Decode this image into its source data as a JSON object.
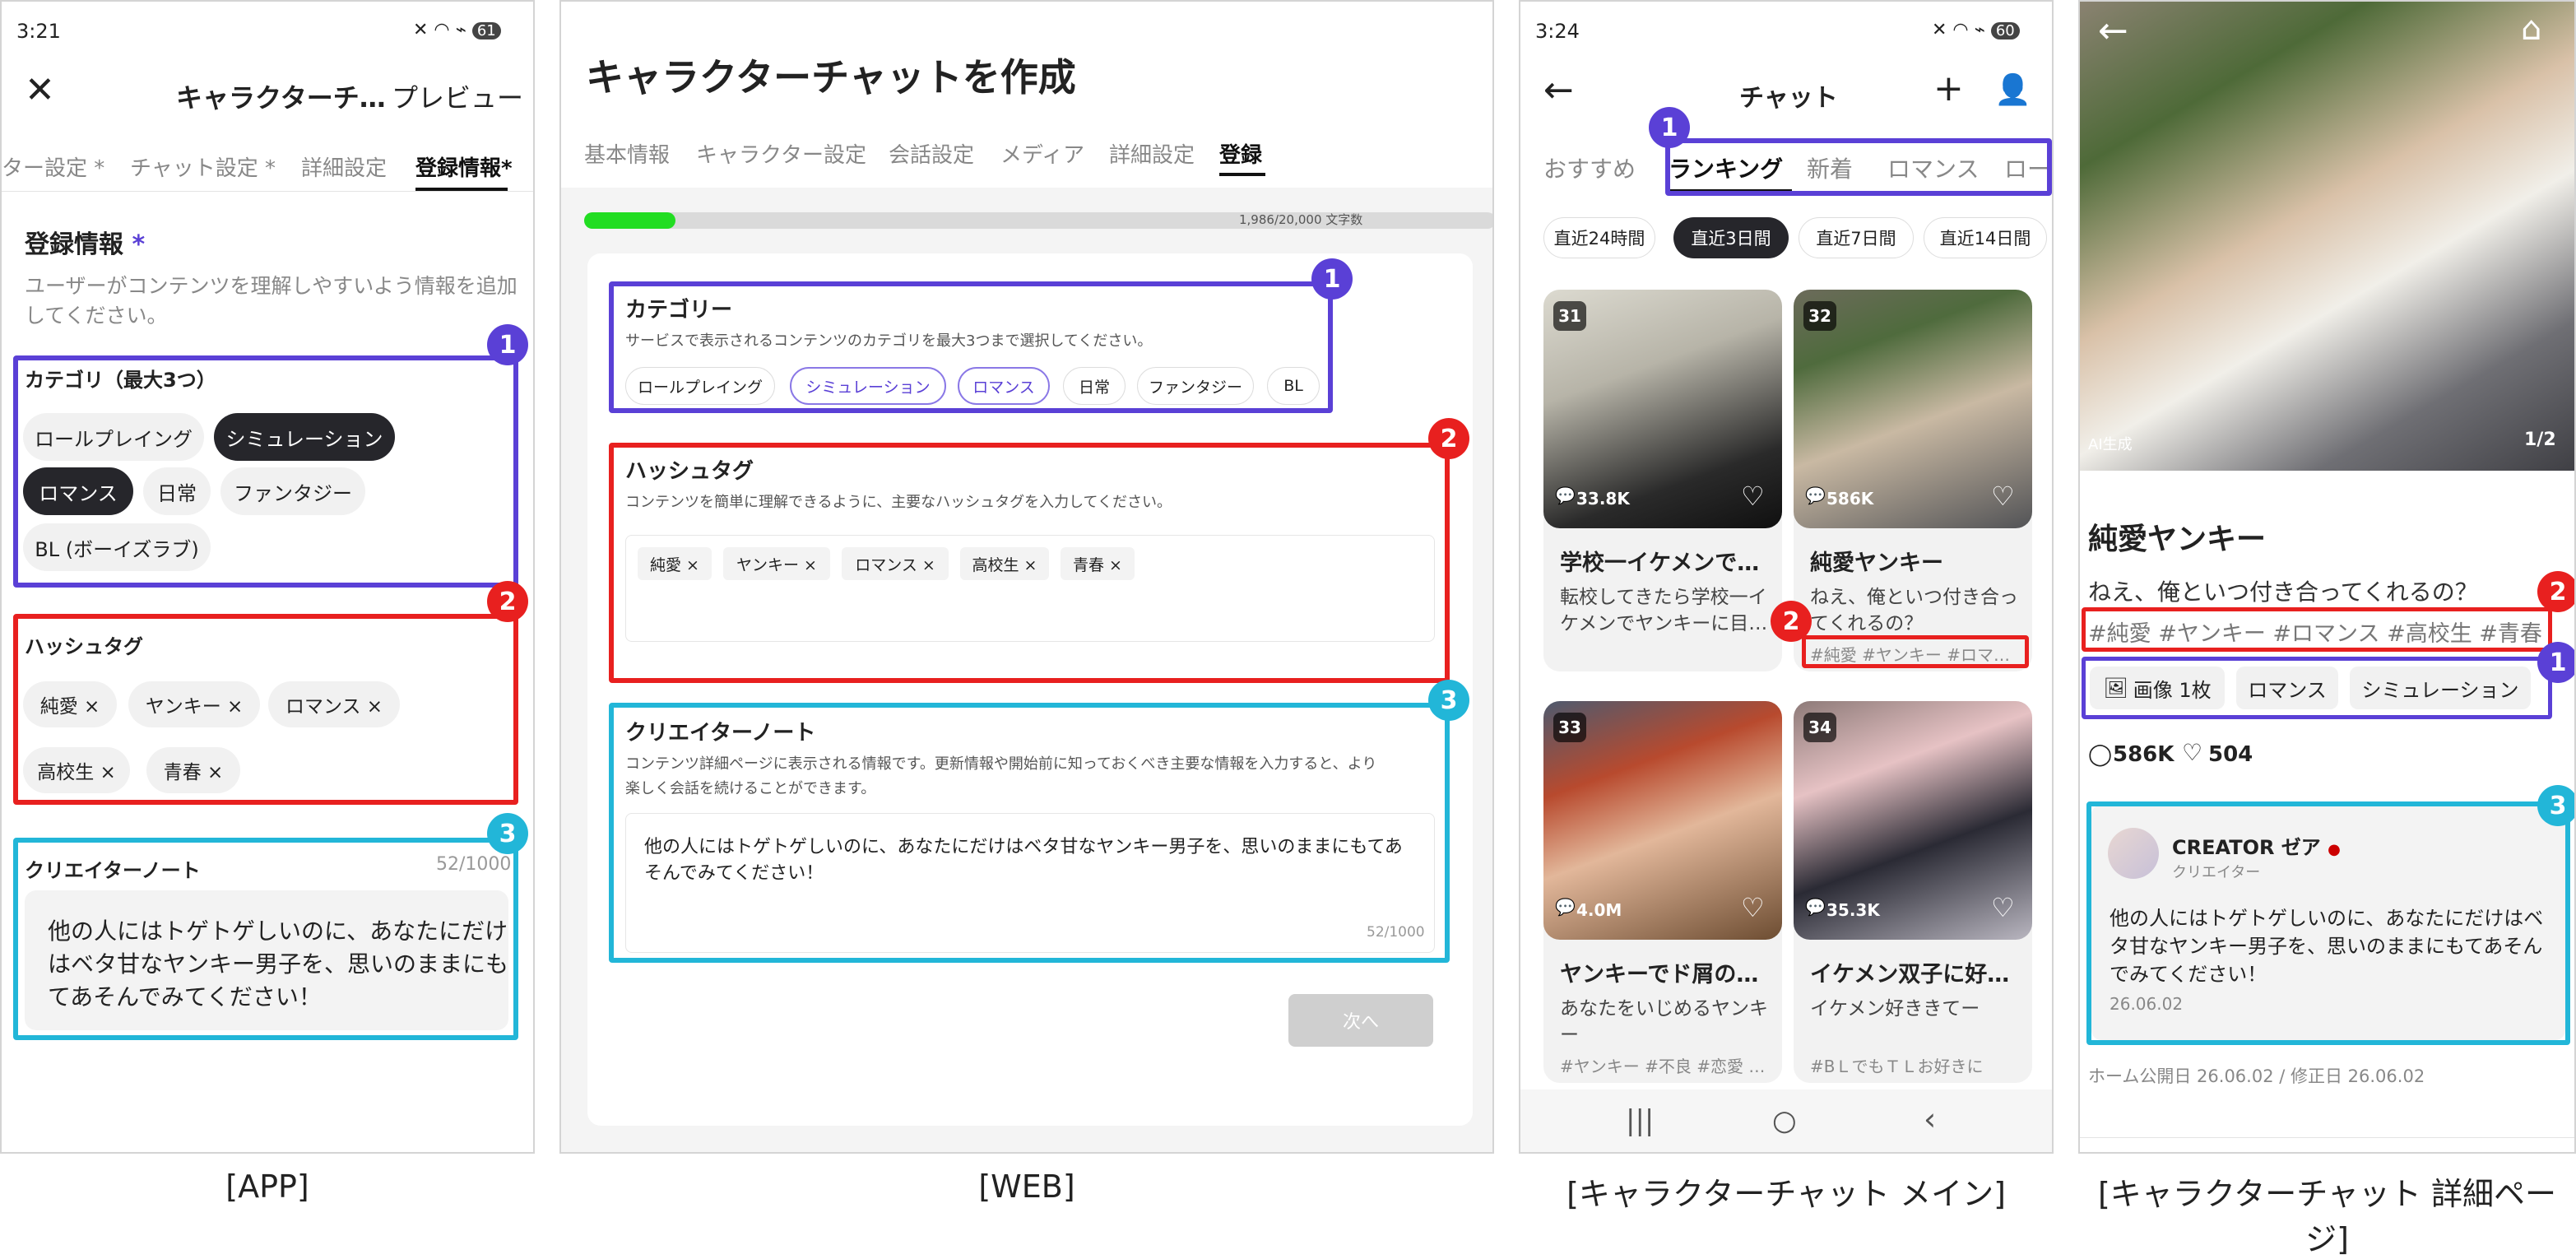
{
  "captions": {
    "app": "[APP]",
    "web": "[WEB]",
    "main": "[キャラクターチャット メイン]",
    "detail": "[キャラクターチャット 詳細ページ]"
  },
  "markers": {
    "one": "1",
    "two": "2",
    "three": "3"
  },
  "app": {
    "status_time": "3:21",
    "status_battery": "61",
    "title": "キャラクターチ…",
    "preview": "プレビュー",
    "tabs": [
      "ター設定 *",
      "チャット設定 *",
      "詳細設定",
      "登録情報*"
    ],
    "section_title": "登録情報",
    "required_mark": "*",
    "section_desc_1": "ユーザーがコンテンツを理解しやすいよう情報を追加",
    "section_desc_2": "してください。",
    "category_label": "カテゴリ（最大3つ）",
    "categories": [
      "ロールプレイング",
      "シミュレーション",
      "ロマンス",
      "日常",
      "ファンタジー",
      "BL (ボーイズラブ)"
    ],
    "hashtag_label": "ハッシュタグ",
    "hashtags": [
      "純愛 ×",
      "ヤンキー ×",
      "ロマンス ×",
      "高校生 ×",
      "青春 ×"
    ],
    "note_label": "クリエイターノート",
    "note_count": "52/1000",
    "note_text_1": "他の人にはトゲトゲしいのに、あなたにだけ",
    "note_text_2": "はベタ甘なヤンキー男子を、思いのままにも",
    "note_text_3": "てあそんでみてください！"
  },
  "web": {
    "title": "キャラクターチャットを作成",
    "tabs": [
      "基本情報",
      "キャラクター設定",
      "会話設定",
      "メディア",
      "詳細設定",
      "登録"
    ],
    "progress_label": "1,986/20,000 文字数",
    "progress": 0.1,
    "category_title": "カテゴリー",
    "category_desc": "サービスで表示されるコンテンツのカテゴリを最大3つまで選択してください。",
    "categories": [
      "ロールプレイング",
      "シミュレーション",
      "ロマンス",
      "日常",
      "ファンタジー",
      "BL"
    ],
    "hashtag_title": "ハッシュタグ",
    "hashtag_desc": "コンテンツを簡単に理解できるように、主要なハッシュタグを入力してください。",
    "hashtags": [
      "純愛 ×",
      "ヤンキー ×",
      "ロマンス ×",
      "高校生 ×",
      "青春 ×"
    ],
    "note_title": "クリエイターノート",
    "note_desc_1": "コンテンツ詳細ページに表示される情報です。更新情報や開始前に知っておくべき主要な情報を入力すると、より",
    "note_desc_2": "楽しく会話を続けることができます。",
    "note_text_1": "他の人にはトゲトゲしいのに、あなたにだけはベタ甘なヤンキー男子を、思いのままにもてあ",
    "note_text_2": "そんでみてください！",
    "note_count": "52/1000",
    "next_button": "次へ"
  },
  "main": {
    "status_time": "3:24",
    "status_battery": "60",
    "title": "チャット",
    "tabs": [
      "おすすめ",
      "ランキング",
      "新着",
      "ロマンス",
      "ロー"
    ],
    "filters": [
      "直近24時間",
      "直近3日間",
      "直近7日間",
      "直近14日間"
    ],
    "cards": [
      {
        "rank": "31",
        "views": "33.8K",
        "title": "学校一イケメンで…",
        "desc_1": "転校してきたら学校一イ",
        "desc_2": "ケメンでヤンキーに目…",
        "tags": ""
      },
      {
        "rank": "32",
        "views": "586K",
        "title": "純愛ヤンキー",
        "desc_1": "ねえ、俺といつ付き合っ",
        "desc_2": "てくれるの？",
        "tags": "#純愛 #ヤンキー #ロマ…"
      },
      {
        "rank": "33",
        "views": "4.0M",
        "title": "ヤンキーでド屑の…",
        "desc_1": "あなたをいじめるヤンキ",
        "desc_2": "ー",
        "tags": "#ヤンキー #不良 #恋愛 …"
      },
      {
        "rank": "34",
        "views": "35.3K",
        "title": "イケメン双子に好…",
        "desc_1": "イケメン好ききてー",
        "desc_2": "",
        "tags": "#BＬでもＴＬお好きに"
      }
    ]
  },
  "detail": {
    "ai_label": "AI生成",
    "image_counter": "1/2",
    "title": "純愛ヤンキー",
    "subtitle": "ねえ、俺といつ付き合ってくれるの？",
    "hashtags": "#純愛 #ヤンキー #ロマンス #高校生 #青春",
    "chips": [
      "画像 1枚",
      "ロマンス",
      "シミュレーション"
    ],
    "comments": "586K",
    "likes": "504",
    "creator_name": "CREATOR ゼア",
    "creator_role": "クリエイター",
    "note_1": "他の人にはトゲトゲしいのに、あなたにだけはベ",
    "note_2": "タ甘なヤンキー男子を、思いのままにもてあそん",
    "note_3": "でみてください！",
    "note_date": "26.06.02",
    "publish_info": "ホーム公開日 26.06.02 / 修正日 26.06.02"
  },
  "colors": {
    "purple": "#5a40d6",
    "red": "#e8201f",
    "cyan": "#22b6d8",
    "progress": "#22dd22",
    "dark_chip": "#26262b"
  }
}
